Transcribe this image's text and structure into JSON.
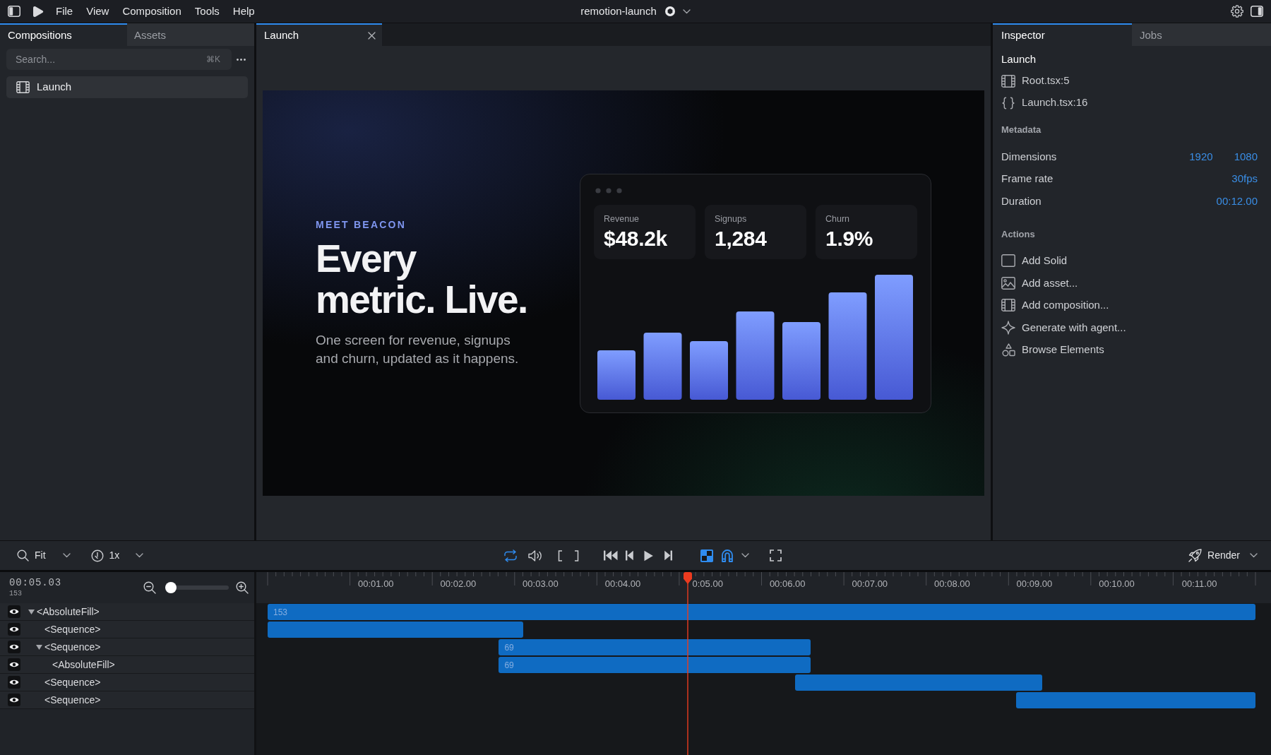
{
  "top_bar": {
    "menu": [
      "File",
      "View",
      "Composition",
      "Tools",
      "Help"
    ],
    "project_title": "remotion-launch"
  },
  "left_panel": {
    "tabs": [
      {
        "label": "Compositions",
        "selected": true
      },
      {
        "label": "Assets",
        "selected": false
      }
    ],
    "search": {
      "placeholder": "Search...",
      "shortcut": "⌘K"
    },
    "compositions": [
      {
        "label": "Launch",
        "selected": true
      }
    ]
  },
  "editor_tabs": [
    {
      "label": "Launch",
      "selected": true
    }
  ],
  "preview": {
    "eyebrow": "MEET BEACON",
    "headline_lines": [
      "Every",
      "metric. Live."
    ],
    "subtitle_lines": [
      "One screen for revenue, signups",
      "and churn, updated as it happens."
    ],
    "stats": [
      {
        "label": "Revenue",
        "value": "$48.2k"
      },
      {
        "label": "Signups",
        "value": "1,284"
      },
      {
        "label": "Churn",
        "value": "1.9%"
      }
    ]
  },
  "inspector": {
    "tabs": [
      {
        "label": "Inspector",
        "selected": true
      },
      {
        "label": "Jobs",
        "selected": false
      }
    ],
    "title": "Launch",
    "sources": [
      {
        "kind": "composition",
        "label": "Root.tsx:5"
      },
      {
        "kind": "code",
        "label": "Launch.tsx:16"
      }
    ],
    "metadata": {
      "heading": "Metadata",
      "rows": [
        {
          "label": "Dimensions",
          "values": [
            "1920",
            "1080"
          ]
        },
        {
          "label": "Frame rate",
          "values": [
            "30fps"
          ]
        },
        {
          "label": "Duration",
          "values": [
            "00:12.00"
          ]
        }
      ]
    },
    "actions": {
      "heading": "Actions",
      "items": [
        {
          "kind": "solid",
          "label": "Add Solid"
        },
        {
          "kind": "asset",
          "label": "Add asset..."
        },
        {
          "kind": "composition",
          "label": "Add composition..."
        },
        {
          "kind": "agent",
          "label": "Generate with agent..."
        },
        {
          "kind": "elements",
          "label": "Browse Elements"
        }
      ]
    }
  },
  "toolbar": {
    "zoom_label": "Fit",
    "speed_label": "1x",
    "loop": {
      "on": true
    },
    "volume": {
      "muted": false
    },
    "checkerboard": {
      "on": true
    },
    "snap": {
      "on": true
    },
    "render_label": "Render"
  },
  "timeline": {
    "timecode": "00:05.03",
    "frame": "153",
    "zoom_slider": {
      "level": 0
    },
    "ruler_labels": [
      "00:01.00",
      "00:02.00",
      "00:03.00",
      "00:04.00",
      "0:05.00",
      "00:06.00",
      "00:07.00",
      "00:08.00",
      "00:09.00",
      "00:10.00",
      "00:11.00"
    ],
    "playhead": {
      "level": 0.425
    },
    "tracks": [
      {
        "label": "<AbsoluteFill>",
        "visible": true,
        "expanded": true,
        "bar_label": "153",
        "children": [
          {
            "label": "<Sequence>",
            "visible": true
          },
          {
            "label": "<Sequence>",
            "visible": true,
            "expanded": true,
            "bar_label": "69",
            "children": [
              {
                "label": "<AbsoluteFill>",
                "visible": true,
                "bar_label": "69"
              }
            ]
          },
          {
            "label": "<Sequence>",
            "visible": true
          },
          {
            "label": "<Sequence>",
            "visible": true
          }
        ]
      }
    ]
  }
}
